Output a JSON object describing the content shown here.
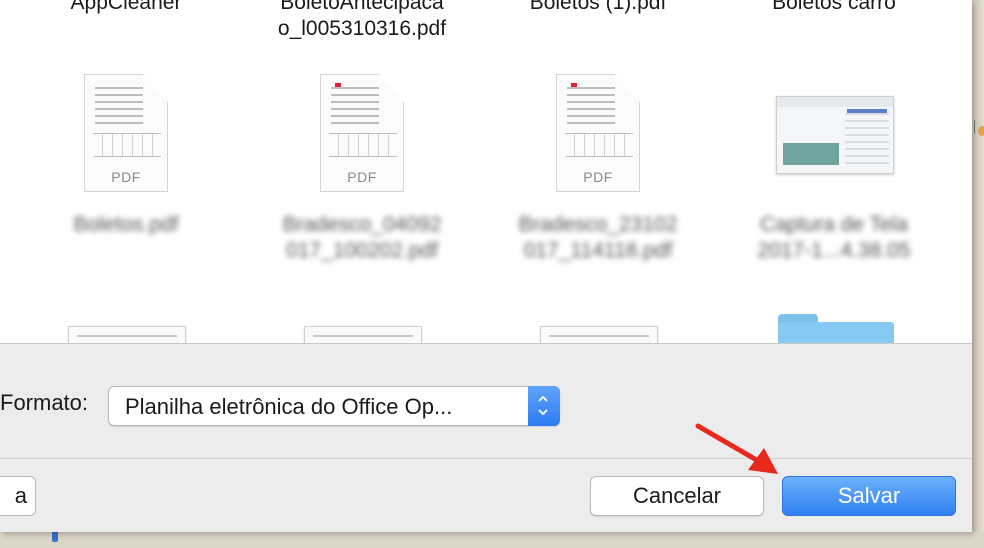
{
  "dialog": {
    "files_row_top": [
      {
        "name": "AppCleaner",
        "blurred": false
      },
      {
        "name": "BoletoAntecipaca\no_l005310316.pdf",
        "blurred": false
      },
      {
        "name": "Boletos (1).pdf",
        "blurred": false
      },
      {
        "name": "Boletos carro",
        "blurred": false
      }
    ],
    "files_row_mid": [
      {
        "name": "Boletos.pdf",
        "icon": "pdf-icon",
        "ext": "PDF"
      },
      {
        "name": "Bradesco_04092\n017_100202.pdf",
        "icon": "pdf-icon",
        "ext": "PDF"
      },
      {
        "name": "Bradesco_23102\n017_114118.pdf",
        "icon": "pdf-icon",
        "ext": "PDF"
      },
      {
        "name": "Captura de Tela\n2017-1...4.38.05",
        "icon": "screenshot-thumbnail"
      }
    ],
    "format": {
      "label": "Formato:",
      "selected": "Planilha eletrônica do Office Op..."
    },
    "buttons": {
      "left_partial": "a",
      "cancel": "Cancelar",
      "save": "Salvar"
    }
  },
  "colors": {
    "accent": "#2f80f1",
    "annotation_arrow": "#e8281c",
    "dialog_bg": "#ececec"
  }
}
